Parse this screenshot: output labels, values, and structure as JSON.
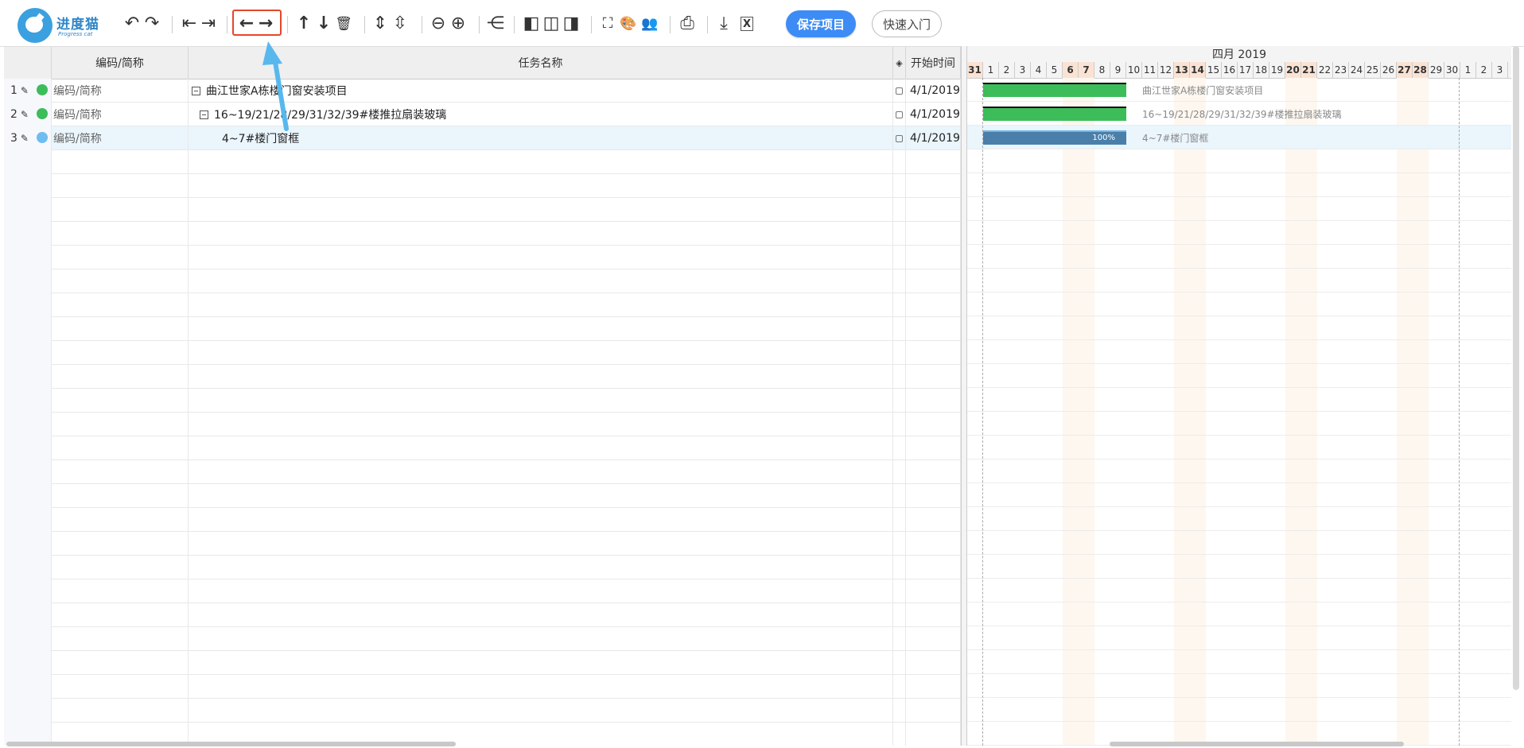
{
  "app": {
    "logo_name": "进度猫",
    "logo_sub": "Progress cat"
  },
  "toolbar": {
    "undo_icon": "↶",
    "redo_icon": "↷",
    "outdent_icon": "⇤",
    "indent_icon": "⇥",
    "move_left_icon": "←",
    "move_right_icon": "→",
    "move_up_icon": "↑",
    "move_down_icon": "↓",
    "delete_icon": "🗑",
    "expand_icon": "⇕",
    "collapse_icon": "⇳",
    "zoom_out_icon": "⊖",
    "zoom_in_icon": "⊕",
    "link_icon": "⋲",
    "layout_left_icon": "◧",
    "layout_both_icon": "◫",
    "layout_right_icon": "◨",
    "fullscreen_icon": "⛶",
    "palette_icon": "🎨",
    "people_icon": "👥",
    "print_icon": "⎙",
    "download_icon": "⤓",
    "excel_icon": "X",
    "save_label": "保存项目",
    "quick_label": "快速入门"
  },
  "grid": {
    "headers": {
      "code": "编码/简称",
      "name": "任务名称",
      "milestone": "◈",
      "start": "开始时间"
    },
    "rows": [
      {
        "num": "1",
        "edit": "✎",
        "status_color": "#3cbd5a",
        "code": "编码/简称",
        "name": "曲江世家A栋楼门窗安装项目",
        "collapsible": true,
        "indent": 0,
        "start": "4/1/2019"
      },
      {
        "num": "2",
        "edit": "✎",
        "status_color": "#3cbd5a",
        "code": "编码/简称",
        "name": "16~19/21/28/29/31/32/39#楼推拉扇装玻璃",
        "collapsible": true,
        "indent": 1,
        "start": "4/1/2019"
      },
      {
        "num": "3",
        "edit": "✎",
        "status_color": "#6fbdf0",
        "code": "编码/简称",
        "name": "4~7#楼门窗框",
        "collapsible": false,
        "indent": 2,
        "start": "4/1/2019"
      }
    ]
  },
  "gantt": {
    "month": "四月 2019",
    "days": [
      "31",
      "1",
      "2",
      "3",
      "4",
      "5",
      "6",
      "7",
      "8",
      "9",
      "10",
      "11",
      "12",
      "13",
      "14",
      "15",
      "16",
      "17",
      "18",
      "19",
      "20",
      "21",
      "22",
      "23",
      "24",
      "25",
      "26",
      "27",
      "28",
      "29",
      "30",
      "1",
      "2",
      "3"
    ],
    "weekend_days": [
      "31",
      "6",
      "7",
      "13",
      "14",
      "20",
      "21",
      "27",
      "28"
    ],
    "bars": [
      {
        "label": "曲江世家A栋楼门窗安装项目",
        "color": "#3cbd5a",
        "top_border": "#111",
        "progress": ""
      },
      {
        "label": "16~19/21/28/29/31/32/39#楼推拉扇装玻璃",
        "color": "#3cbd5a",
        "top_border": "#111",
        "progress": ""
      },
      {
        "label": "4~7#楼门窗框",
        "color": "#4a7faa",
        "top_border": "#6fb7ea",
        "progress": "100%"
      }
    ]
  }
}
